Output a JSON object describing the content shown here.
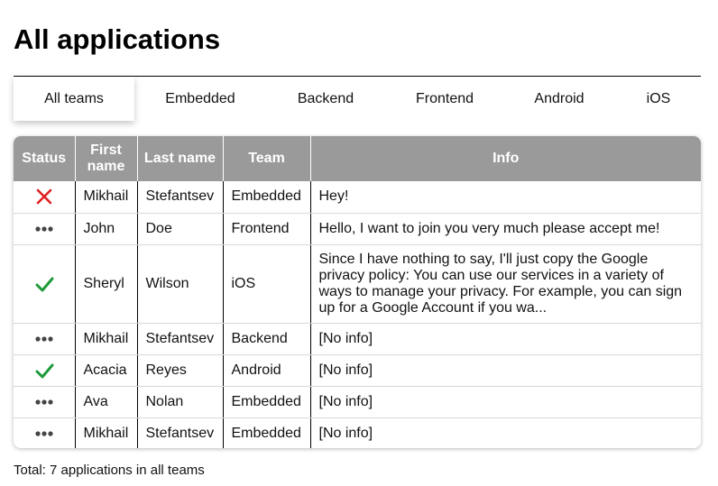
{
  "page": {
    "title": "All applications"
  },
  "tabs": [
    {
      "label": "All teams",
      "active": true
    },
    {
      "label": "Embedded",
      "active": false
    },
    {
      "label": "Backend",
      "active": false
    },
    {
      "label": "Frontend",
      "active": false
    },
    {
      "label": "Android",
      "active": false
    },
    {
      "label": "iOS",
      "active": false
    }
  ],
  "table": {
    "headers": [
      "Status",
      "First name",
      "Last name",
      "Team",
      "Info"
    ],
    "rows": [
      {
        "status": "rejected",
        "first_name": "Mikhail",
        "last_name": "Stefantsev",
        "team": "Embedded",
        "info": "Hey!"
      },
      {
        "status": "pending",
        "first_name": "John",
        "last_name": "Doe",
        "team": "Frontend",
        "info": "Hello, I want to join you very much please accept me!"
      },
      {
        "status": "accepted",
        "first_name": "Sheryl",
        "last_name": "Wilson",
        "team": "iOS",
        "info": "Since I have nothing to say, I'll just copy the Google privacy policy: You can use our services in a variety of ways to manage your privacy. For example, you can sign up for a Google Account if you wa..."
      },
      {
        "status": "pending",
        "first_name": "Mikhail",
        "last_name": "Stefantsev",
        "team": "Backend",
        "info": "[No info]"
      },
      {
        "status": "accepted",
        "first_name": "Acacia",
        "last_name": "Reyes",
        "team": "Android",
        "info": "[No info]"
      },
      {
        "status": "pending",
        "first_name": "Ava",
        "last_name": "Nolan",
        "team": "Embedded",
        "info": "[No info]"
      },
      {
        "status": "pending",
        "first_name": "Mikhail",
        "last_name": "Stefantsev",
        "team": "Embedded",
        "info": "[No info]"
      }
    ]
  },
  "status_icons": {
    "rejected": {
      "icon": "x-icon",
      "color": "#e02020"
    },
    "pending": {
      "icon": "ellipsis-icon",
      "color": "#444444"
    },
    "accepted": {
      "icon": "checkmark-icon",
      "color": "#1f9a3a"
    }
  },
  "footer": {
    "total_text": "Total: 7 applications in all teams"
  },
  "colors": {
    "header_bg": "#9a9a9a",
    "header_text": "#ffffff"
  }
}
